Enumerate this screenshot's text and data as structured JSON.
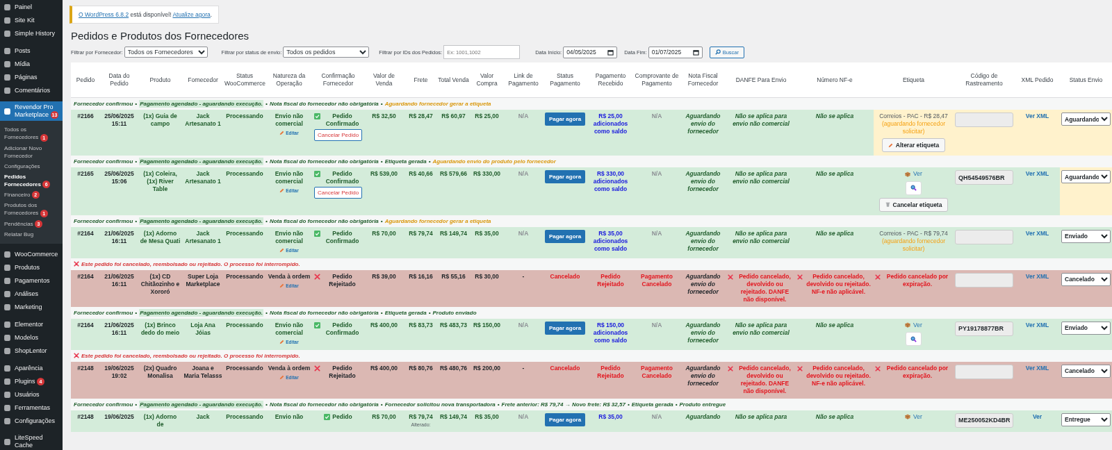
{
  "sidebar": {
    "groups": [
      {
        "items": [
          {
            "label": "Painel",
            "selected": false
          },
          {
            "label": "Site Kit",
            "selected": false
          },
          {
            "label": "Simple History",
            "selected": false
          }
        ]
      },
      {
        "items": [
          {
            "label": "Posts",
            "selected": false
          },
          {
            "label": "Mídia",
            "selected": false
          },
          {
            "label": "Páginas",
            "selected": false
          },
          {
            "label": "Comentários",
            "selected": false
          }
        ]
      },
      {
        "items": [
          {
            "label": "Revendor Pro Marketplace",
            "badge": "13",
            "selected": true,
            "children": [
              {
                "label": "Todos os Fornecedores",
                "badge": "1",
                "selected": false
              },
              {
                "label": "Adicionar Novo Fornecedor",
                "selected": false
              },
              {
                "label": "Configurações",
                "selected": false
              },
              {
                "label": "Pedidos Fornecedores",
                "badge": "6",
                "selected": true
              },
              {
                "label": "Financeiro",
                "badge": "2",
                "selected": false
              },
              {
                "label": "Produtos dos Fornecedores",
                "badge": "1",
                "selected": false
              },
              {
                "label": "Pendências",
                "badge": "3",
                "selected": false
              },
              {
                "label": "Relatar Bug",
                "selected": false
              }
            ]
          }
        ]
      },
      {
        "items": [
          {
            "label": "WooCommerce",
            "selected": false
          },
          {
            "label": "Produtos",
            "selected": false
          },
          {
            "label": "Pagamentos",
            "selected": false
          },
          {
            "label": "Análises",
            "selected": false
          },
          {
            "label": "Marketing",
            "selected": false
          }
        ]
      },
      {
        "items": [
          {
            "label": "Elementor",
            "selected": false
          },
          {
            "label": "Modelos",
            "selected": false
          },
          {
            "label": "ShopLentor",
            "selected": false
          }
        ]
      },
      {
        "items": [
          {
            "label": "Aparência",
            "selected": false
          },
          {
            "label": "Plugins",
            "badge": "4",
            "selected": false
          },
          {
            "label": "Usuários",
            "selected": false
          },
          {
            "label": "Ferramentas",
            "selected": false
          },
          {
            "label": "Configurações",
            "selected": false
          }
        ]
      },
      {
        "items": [
          {
            "label": "LiteSpeed Cache",
            "selected": false
          }
        ]
      }
    ]
  },
  "notice": {
    "version_link": "O WordPress 6.8.2",
    "text": "está disponível!",
    "update_link": "Atualize agora",
    "end": "."
  },
  "title": "Pedidos e Produtos dos Fornecedores",
  "filters": {
    "supplier_label": "Filtrar por Fornecedor:",
    "supplier_value": "Todos os Fornecedores",
    "status_label": "Filtrar por status de envio:",
    "status_value": "Todos os pedidos",
    "ids_label": "Filtrar por IDs dos Pedidos:",
    "ids_placeholder": "Ex: 1001,1002",
    "start_label": "Data Início:",
    "start_value": "04/05/2025",
    "end_label": "Data Fim:",
    "end_value": "01/07/2025",
    "search_button": "Buscar"
  },
  "table": {
    "columns": [
      "Pedido",
      "Data do Pedido",
      "Produto",
      "Fornecedor",
      "Status WooCommerce",
      "Natureza da Operação",
      "Confirmação Fornecedor",
      "Valor de Venda",
      "Frete",
      "Total Venda",
      "Valor Compra",
      "Link de Pagamento",
      "Status Pagamento",
      "Pagamento Recebido",
      "Comprovante de Pagamento",
      "Nota Fiscal Fornecedor",
      "DANFE Para Envio",
      "Número NF-e",
      "Etiqueta",
      "Código de Rastreamento",
      "XML Pedido",
      "Status Envio"
    ],
    "orders": [
      {
        "note": [
          {
            "kind": "done",
            "text": "Fornecedor confirmou"
          },
          {
            "kind": "sep",
            "text": "•"
          },
          {
            "kind": "paid",
            "text": "Pagamento agendado - aguardando execução."
          },
          {
            "kind": "sep",
            "text": "•"
          },
          {
            "kind": "done",
            "text": "Nota fiscal do fornecedor não obrigatória"
          },
          {
            "kind": "sep",
            "text": "•"
          },
          {
            "kind": "pending",
            "text": "Aguardando fornecedor gerar a etiqueta"
          }
        ],
        "cancelled": false,
        "label_highlighted": true,
        "shipping_highlighted": true,
        "order_id": "#2166",
        "date": "25/06/2025 15:11",
        "product": "(1x) Guia de campo",
        "supplier": "Jack Artesanato 1",
        "woo_status": "Processando",
        "operation": "Envio não comercial",
        "edit_link": "Editar",
        "confirmation": {
          "confirmed": true,
          "text": "Pedido Confirmado",
          "cancel_button": "Cancelar Pedido"
        },
        "sale": "R$ 32,50",
        "freight": "R$ 28,47",
        "total": "R$ 60,97",
        "cost": "R$ 25,00",
        "payment_link": "N/A",
        "payment": {
          "kind": "button",
          "text": "Pagar agora"
        },
        "received": "R$ 25,00 adicionados como saldo",
        "proof": "N/A",
        "invoice": "Aguardando envio do fornecedor",
        "danfe": "Não se aplica para envio não comercial",
        "nfe": "Não se aplica",
        "label": {
          "kind": "quote",
          "carrier": "Correios - PAC - R$ 28,47",
          "pending": "(aguardando fornecedor solicitar)",
          "button": "Alterar etiqueta"
        },
        "xml": "Ver XML",
        "shipping": "Aguardando"
      },
      {
        "note": [
          {
            "kind": "done",
            "text": "Fornecedor confirmou"
          },
          {
            "kind": "sep",
            "text": "•"
          },
          {
            "kind": "paid",
            "text": "Pagamento agendado - aguardando execução."
          },
          {
            "kind": "sep",
            "text": "•"
          },
          {
            "kind": "done",
            "text": "Nota fiscal do fornecedor não obrigatória"
          },
          {
            "kind": "sep",
            "text": "•"
          },
          {
            "kind": "done",
            "text": "Etiqueta gerada"
          },
          {
            "kind": "sep",
            "text": "•"
          },
          {
            "kind": "pending",
            "text": "Aguardando envio do produto pelo fornecedor"
          }
        ],
        "cancelled": false,
        "label_highlighted": false,
        "shipping_highlighted": true,
        "order_id": "#2165",
        "date": "25/06/2025 15:06",
        "product": "(1x) Coleira, (1x) River Table",
        "supplier": "Jack Artesanato 1",
        "woo_status": "Processando",
        "operation": "Envio não comercial",
        "edit_link": "Editar",
        "confirmation": {
          "confirmed": true,
          "text": "Pedido Confirmado",
          "cancel_button": "Cancelar Pedido"
        },
        "sale": "R$ 539,00",
        "freight": "R$ 40,66",
        "total": "R$ 579,66",
        "cost": "R$ 330,00",
        "payment_link": "N/A",
        "payment": {
          "kind": "button",
          "text": "Pagar agora"
        },
        "received": "R$ 330,00 adicionados como saldo",
        "proof": "N/A",
        "invoice": "Aguardando envio do fornecedor",
        "danfe": "Não se aplica para envio não comercial",
        "nfe": "Não se aplica",
        "label": {
          "kind": "label",
          "link": "Ver",
          "button": "Cancelar etiqueta"
        },
        "tracking": "QH54549576BR",
        "xml": "Ver XML",
        "shipping": "Aguardando"
      },
      {
        "note": [
          {
            "kind": "done",
            "text": "Fornecedor confirmou"
          },
          {
            "kind": "sep",
            "text": "•"
          },
          {
            "kind": "paid",
            "text": "Pagamento agendado - aguardando execução."
          },
          {
            "kind": "sep",
            "text": "•"
          },
          {
            "kind": "done",
            "text": "Nota fiscal do fornecedor não obrigatória"
          },
          {
            "kind": "sep",
            "text": "•"
          },
          {
            "kind": "pending",
            "text": "Aguardando fornecedor gerar a etiqueta"
          }
        ],
        "cancelled": false,
        "label_highlighted": false,
        "shipping_highlighted": false,
        "order_id": "#2164",
        "date": "21/06/2025 16:11",
        "product": "(1x) Adorno de Mesa Quati",
        "supplier": "Jack Artesanato 1",
        "woo_status": "Processando",
        "operation": "Envio não comercial",
        "edit_link": "Editar",
        "confirmation": {
          "confirmed": true,
          "text": "Pedido Confirmado"
        },
        "sale": "R$ 70,00",
        "freight": "R$ 79,74",
        "total": "R$ 149,74",
        "cost": "R$ 35,00",
        "payment_link": "N/A",
        "payment": {
          "kind": "button",
          "text": "Pagar agora"
        },
        "received": "R$ 35,00 adicionados como saldo",
        "proof": "N/A",
        "invoice": "Aguardando envio do fornecedor",
        "danfe": "Não se aplica para envio não comercial",
        "nfe": "Não se aplica",
        "label": {
          "kind": "quote",
          "carrier": "Correios - PAC - R$ 79,74",
          "pending": "(aguardando fornecedor solicitar)"
        },
        "xml": "Ver XML",
        "shipping": "Enviado"
      },
      {
        "note": [
          {
            "kind": "cancelled",
            "text": "Este pedido foi cancelado, reembolsado ou rejeitado. O processo foi interrompido."
          }
        ],
        "cancelled": true,
        "label_highlighted": false,
        "shipping_highlighted": false,
        "order_id": "#2164",
        "date": "21/06/2025 16:11",
        "product": "(1x) CD Chitãozinho e Xororó",
        "supplier": "Super Loja Marketplace",
        "woo_status": "Processando",
        "operation": "Venda à ordem",
        "edit_link": "Editar",
        "confirmation": {
          "confirmed": false,
          "text": "Pedido Rejeitado"
        },
        "sale": "R$ 39,00",
        "freight": "R$ 16,16",
        "total": "R$ 55,16",
        "cost": "R$ 30,00",
        "payment_link": "-",
        "payment": {
          "kind": "status",
          "text": "Cancelado"
        },
        "received": "Pedido Rejeitado",
        "proof": "Pagamento Cancelado",
        "invoice": "Aguardando envio do fornecedor",
        "danfe": "Pedido cancelado, devolvido ou rejeitado. DANFE não disponível.",
        "nfe": "Pedido cancelado, devolvido ou rejeitado. NF-e não aplicável.",
        "label": {
          "kind": "cancelled",
          "text": "Pedido cancelado por expiração."
        },
        "xml": "Ver XML",
        "shipping": "Cancelado"
      },
      {
        "note": [
          {
            "kind": "done",
            "text": "Fornecedor confirmou"
          },
          {
            "kind": "sep",
            "text": "•"
          },
          {
            "kind": "paid",
            "text": "Pagamento agendado - aguardando execução."
          },
          {
            "kind": "sep",
            "text": "•"
          },
          {
            "kind": "done",
            "text": "Nota fiscal do fornecedor não obrigatória"
          },
          {
            "kind": "sep",
            "text": "•"
          },
          {
            "kind": "done",
            "text": "Etiqueta gerada"
          },
          {
            "kind": "sep",
            "text": "•"
          },
          {
            "kind": "done",
            "text": "Produto enviado"
          }
        ],
        "cancelled": false,
        "label_highlighted": false,
        "shipping_highlighted": false,
        "order_id": "#2164",
        "date": "21/06/2025 16:11",
        "product": "(1x) Brinco dedo do meio",
        "supplier": "Loja Ana Jóias",
        "woo_status": "Processando",
        "operation": "Envio não comercial",
        "edit_link": "Editar",
        "confirmation": {
          "confirmed": true,
          "text": "Pedido Confirmado"
        },
        "sale": "R$ 400,00",
        "freight": "R$ 83,73",
        "total": "R$ 483,73",
        "cost": "R$ 150,00",
        "payment_link": "N/A",
        "payment": {
          "kind": "button",
          "text": "Pagar agora"
        },
        "received": "R$ 150,00 adicionados como saldo",
        "proof": "N/A",
        "invoice": "Aguardando envio do fornecedor",
        "danfe": "Não se aplica para envio não comercial",
        "nfe": "Não se aplica",
        "label": {
          "kind": "label",
          "link": "Ver"
        },
        "tracking": "PY19178877BR",
        "xml": "Ver XML",
        "shipping": "Enviado"
      },
      {
        "note": [
          {
            "kind": "cancelled",
            "text": "Este pedido foi cancelado, reembolsado ou rejeitado. O processo foi interrompido."
          }
        ],
        "cancelled": true,
        "label_highlighted": false,
        "shipping_highlighted": false,
        "order_id": "#2148",
        "date": "19/06/2025 19:02",
        "product": "(2x) Quadro Monalisa",
        "supplier": "Joana e Maria Telasss",
        "woo_status": "Processando",
        "operation": "Venda à ordem",
        "edit_link": "Editar",
        "confirmation": {
          "confirmed": false,
          "text": "Pedido Rejeitado"
        },
        "sale": "R$ 400,00",
        "freight": "R$ 80,76",
        "total": "R$ 480,76",
        "cost": "R$ 200,00",
        "payment_link": "-",
        "payment": {
          "kind": "status",
          "text": "Cancelado"
        },
        "received": "Pedido Rejeitado",
        "proof": "Pagamento Cancelado",
        "invoice": "Aguardando envio do fornecedor",
        "danfe": "Pedido cancelado, devolvido ou rejeitado. DANFE não disponível.",
        "nfe": "Pedido cancelado, devolvido ou rejeitado. NF-e não aplicável.",
        "label": {
          "kind": "cancelled",
          "text": "Pedido cancelado por expiração."
        },
        "xml": "Ver XML",
        "shipping": "Cancelado"
      },
      {
        "note": [
          {
            "kind": "done",
            "text": "Fornecedor confirmou"
          },
          {
            "kind": "sep",
            "text": "•"
          },
          {
            "kind": "paid",
            "text": "Pagamento agendado - aguardando execução."
          },
          {
            "kind": "sep",
            "text": "•"
          },
          {
            "kind": "done",
            "text": "Nota fiscal do fornecedor não obrigatória"
          },
          {
            "kind": "sep",
            "text": "•"
          },
          {
            "kind": "done",
            "text": "Fornecedor solicitou nova transportadora"
          },
          {
            "kind": "sep",
            "text": "•"
          },
          {
            "kind": "done",
            "text": "Frete anterior: R$ 79,74 → Novo frete: R$ 32,57"
          },
          {
            "kind": "sep",
            "text": "•"
          },
          {
            "kind": "done",
            "text": "Etiqueta gerada"
          },
          {
            "kind": "sep",
            "text": "•"
          },
          {
            "kind": "done",
            "text": "Produto entregue"
          }
        ],
        "cancelled": false,
        "label_highlighted": false,
        "shipping_highlighted": false,
        "order_id": "#2148",
        "date": "19/06/2025",
        "product": "(1x) Adorno de",
        "supplier": "Jack",
        "woo_status": "Processando",
        "operation": "Envio não",
        "confirmation": {
          "confirmed": true,
          "text": "Pedido"
        },
        "sale": "R$ 70,00",
        "freight": "R$ 79,74",
        "freight_note": "Alterado:",
        "total": "R$ 149,74",
        "cost": "R$ 35,00",
        "payment_link": "N/A",
        "payment": {
          "kind": "button",
          "text": "Pagar agora"
        },
        "received": "R$ 35,00",
        "proof": "N/A",
        "invoice": "Aguardando",
        "danfe": "Não se aplica para",
        "nfe": "Não se aplica",
        "label": {
          "kind": "label",
          "link": "Ver"
        },
        "tracking": "ME250052KD4BR",
        "xml": "Ver",
        "shipping": "Entregue"
      }
    ]
  }
}
